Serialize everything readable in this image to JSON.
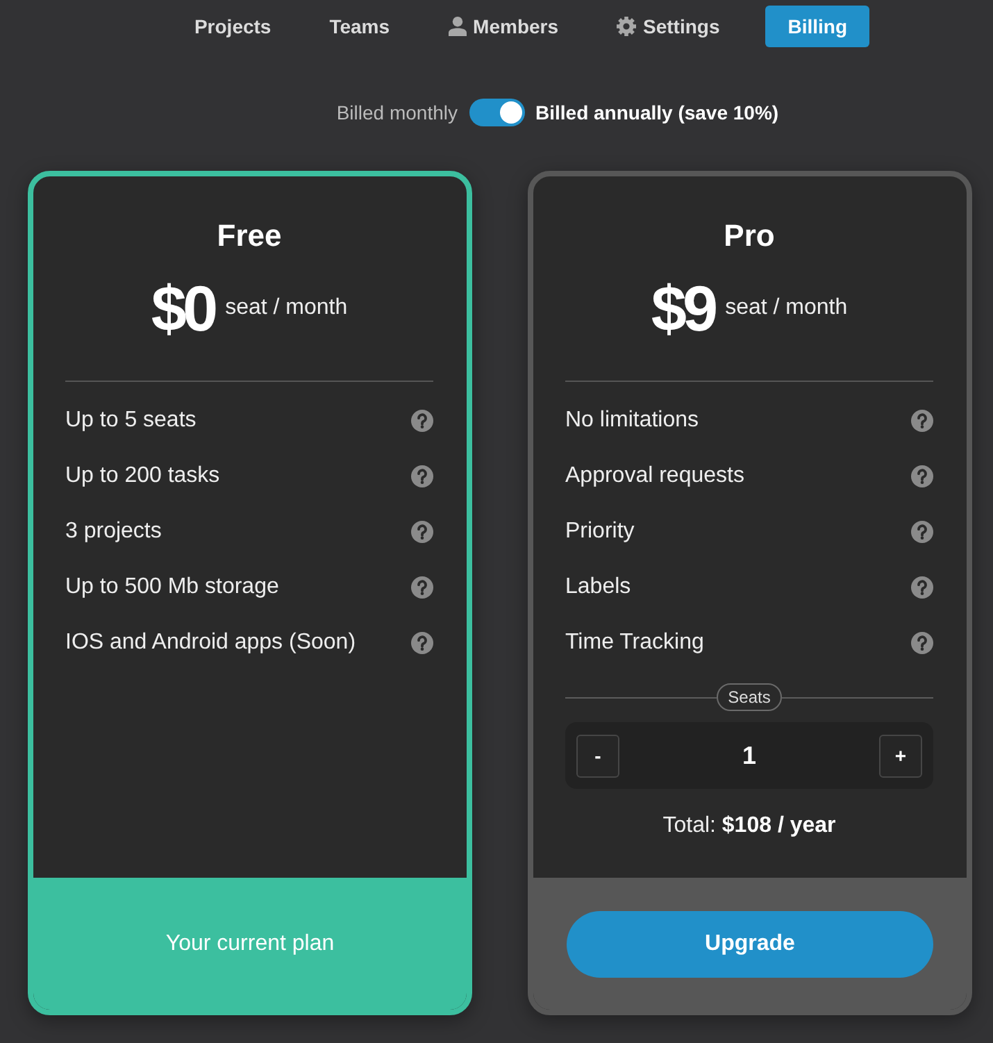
{
  "nav": {
    "tabs": [
      {
        "label": "Projects",
        "kind": "plain",
        "selected": false
      },
      {
        "label": "Teams",
        "kind": "plain",
        "selected": false
      },
      {
        "label": "Members",
        "kind": "person",
        "selected": false
      },
      {
        "label": "Settings",
        "kind": "gear",
        "selected": false
      },
      {
        "label": "Billing",
        "kind": "plain",
        "selected": true
      }
    ]
  },
  "billing_toggle": {
    "off_label": "Billed monthly",
    "on_label": "Billed annually (save 10%)",
    "on": true
  },
  "plans": [
    {
      "name": "Free",
      "price": "$0",
      "unit": "seat / month",
      "current": true,
      "features": [
        "Up to 5 seats",
        "Up to 200 tasks",
        "3 projects",
        "Up to 500 Mb storage",
        "IOS and Android apps (Soon)"
      ],
      "footer_label": "Your current plan"
    },
    {
      "name": "Pro",
      "price": "$9",
      "unit": "seat / month",
      "current": false,
      "features": [
        "No limitations",
        "Approval requests",
        "Priority",
        "Labels",
        "Time Tracking"
      ],
      "seats": {
        "label": "Seats",
        "decrement": "-",
        "value": "1",
        "increment": "+"
      },
      "total": "Total: **$108 / year**",
      "footer_label": "Upgrade"
    }
  ]
}
